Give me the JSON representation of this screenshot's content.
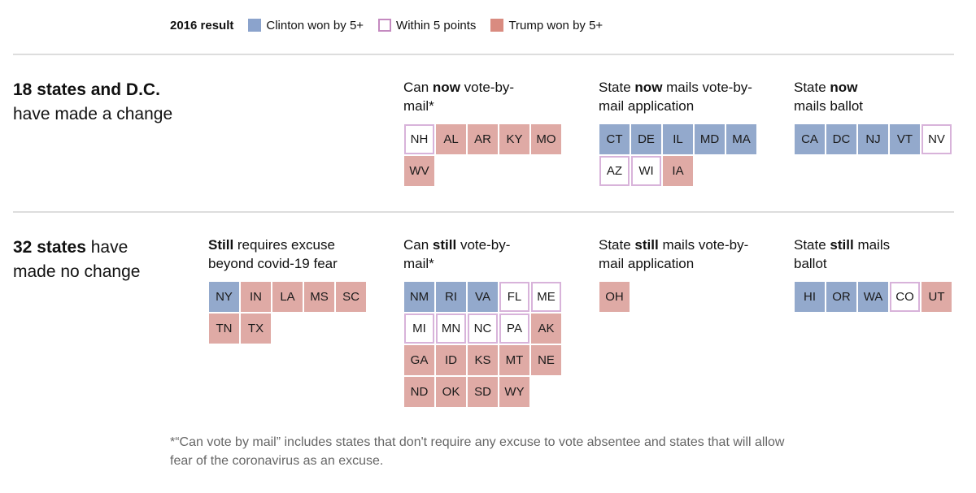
{
  "colors": {
    "clinton": "#93a9cc",
    "within": "#ffffff",
    "within_border": "#d8b3da",
    "trump": "#dfaaa5",
    "legend_clinton": "#8ba3cc",
    "legend_trump": "#d98b80",
    "legend_within_border": "#c48ac0"
  },
  "legend": {
    "title": "2016 result",
    "items": [
      {
        "key": "clinton",
        "label": "Clinton won by 5+"
      },
      {
        "key": "within",
        "label": "Within 5 points"
      },
      {
        "key": "trump",
        "label": "Trump won by 5+"
      }
    ]
  },
  "sections": [
    {
      "heading_bold": "18 states and D.C.",
      "heading_rest": " have made a change",
      "groups": [
        {
          "title_pre": "Can ",
          "title_bold": "now",
          "title_post": " vote-by-mail*",
          "states": [
            {
              "abbr": "NH",
              "result": "within"
            },
            {
              "abbr": "AL",
              "result": "trump"
            },
            {
              "abbr": "AR",
              "result": "trump"
            },
            {
              "abbr": "KY",
              "result": "trump"
            },
            {
              "abbr": "MO",
              "result": "trump"
            },
            {
              "abbr": "WV",
              "result": "trump"
            }
          ]
        },
        {
          "title_pre": "State ",
          "title_bold": "now",
          "title_post": " mails vote-by-mail application",
          "states": [
            {
              "abbr": "CT",
              "result": "clinton"
            },
            {
              "abbr": "DE",
              "result": "clinton"
            },
            {
              "abbr": "IL",
              "result": "clinton"
            },
            {
              "abbr": "MD",
              "result": "clinton"
            },
            {
              "abbr": "MA",
              "result": "clinton"
            },
            {
              "abbr": "AZ",
              "result": "within"
            },
            {
              "abbr": "WI",
              "result": "within"
            },
            {
              "abbr": "IA",
              "result": "trump"
            }
          ]
        },
        {
          "title_pre": "State ",
          "title_bold": "now",
          "title_post": " mails ballot",
          "states": [
            {
              "abbr": "CA",
              "result": "clinton"
            },
            {
              "abbr": "DC",
              "result": "clinton"
            },
            {
              "abbr": "NJ",
              "result": "clinton"
            },
            {
              "abbr": "VT",
              "result": "clinton"
            },
            {
              "abbr": "NV",
              "result": "within"
            }
          ]
        }
      ]
    },
    {
      "heading_bold": "32 states",
      "heading_rest": " have made no change",
      "groups": [
        {
          "title_pre": "",
          "title_bold": "Still",
          "title_post": " requires excuse beyond covid-19 fear",
          "states": [
            {
              "abbr": "NY",
              "result": "clinton"
            },
            {
              "abbr": "IN",
              "result": "trump"
            },
            {
              "abbr": "LA",
              "result": "trump"
            },
            {
              "abbr": "MS",
              "result": "trump"
            },
            {
              "abbr": "SC",
              "result": "trump"
            },
            {
              "abbr": "TN",
              "result": "trump"
            },
            {
              "abbr": "TX",
              "result": "trump"
            }
          ]
        },
        {
          "title_pre": "Can ",
          "title_bold": "still",
          "title_post": " vote-by-mail*",
          "states": [
            {
              "abbr": "NM",
              "result": "clinton"
            },
            {
              "abbr": "RI",
              "result": "clinton"
            },
            {
              "abbr": "VA",
              "result": "clinton"
            },
            {
              "abbr": "FL",
              "result": "within"
            },
            {
              "abbr": "ME",
              "result": "within"
            },
            {
              "abbr": "MI",
              "result": "within"
            },
            {
              "abbr": "MN",
              "result": "within"
            },
            {
              "abbr": "NC",
              "result": "within"
            },
            {
              "abbr": "PA",
              "result": "within"
            },
            {
              "abbr": "AK",
              "result": "trump"
            },
            {
              "abbr": "GA",
              "result": "trump"
            },
            {
              "abbr": "ID",
              "result": "trump"
            },
            {
              "abbr": "KS",
              "result": "trump"
            },
            {
              "abbr": "MT",
              "result": "trump"
            },
            {
              "abbr": "NE",
              "result": "trump"
            },
            {
              "abbr": "ND",
              "result": "trump"
            },
            {
              "abbr": "OK",
              "result": "trump"
            },
            {
              "abbr": "SD",
              "result": "trump"
            },
            {
              "abbr": "WY",
              "result": "trump"
            }
          ]
        },
        {
          "title_pre": "State ",
          "title_bold": "still",
          "title_post": " mails vote-by-mail application",
          "states": [
            {
              "abbr": "OH",
              "result": "trump"
            }
          ]
        },
        {
          "title_pre": "State ",
          "title_bold": "still",
          "title_post": " mails ballot",
          "states": [
            {
              "abbr": "HI",
              "result": "clinton"
            },
            {
              "abbr": "OR",
              "result": "clinton"
            },
            {
              "abbr": "WA",
              "result": "clinton"
            },
            {
              "abbr": "CO",
              "result": "within"
            },
            {
              "abbr": "UT",
              "result": "trump"
            }
          ]
        }
      ]
    }
  ],
  "footnote": "*“Can vote by mail” includes states that don't require any excuse to vote absentee and states that will allow fear of the coronavirus as an excuse.",
  "chart_data": {
    "type": "table",
    "title": "",
    "legend": [
      "Clinton won by 5+",
      "Within 5 points",
      "Trump won by 5+"
    ],
    "legend_title": "2016 result",
    "rows": [
      {
        "section": "18 states and D.C. have made a change",
        "category": "Can now vote-by-mail*",
        "states": [
          "NH",
          "AL",
          "AR",
          "KY",
          "MO",
          "WV"
        ]
      },
      {
        "section": "18 states and D.C. have made a change",
        "category": "State now mails vote-by-mail application",
        "states": [
          "CT",
          "DE",
          "IL",
          "MD",
          "MA",
          "AZ",
          "WI",
          "IA"
        ]
      },
      {
        "section": "18 states and D.C. have made a change",
        "category": "State now mails ballot",
        "states": [
          "CA",
          "DC",
          "NJ",
          "VT",
          "NV"
        ]
      },
      {
        "section": "32 states have made no change",
        "category": "Still requires excuse beyond covid-19 fear",
        "states": [
          "NY",
          "IN",
          "LA",
          "MS",
          "SC",
          "TN",
          "TX"
        ]
      },
      {
        "section": "32 states have made no change",
        "category": "Can still vote-by-mail*",
        "states": [
          "NM",
          "RI",
          "VA",
          "FL",
          "ME",
          "MI",
          "MN",
          "NC",
          "PA",
          "AK",
          "GA",
          "ID",
          "KS",
          "MT",
          "NE",
          "ND",
          "OK",
          "SD",
          "WY"
        ]
      },
      {
        "section": "32 states have made no change",
        "category": "State still mails vote-by-mail application",
        "states": [
          "OH"
        ]
      },
      {
        "section": "32 states have made no change",
        "category": "State still mails ballot",
        "states": [
          "HI",
          "OR",
          "WA",
          "CO",
          "UT"
        ]
      }
    ]
  }
}
